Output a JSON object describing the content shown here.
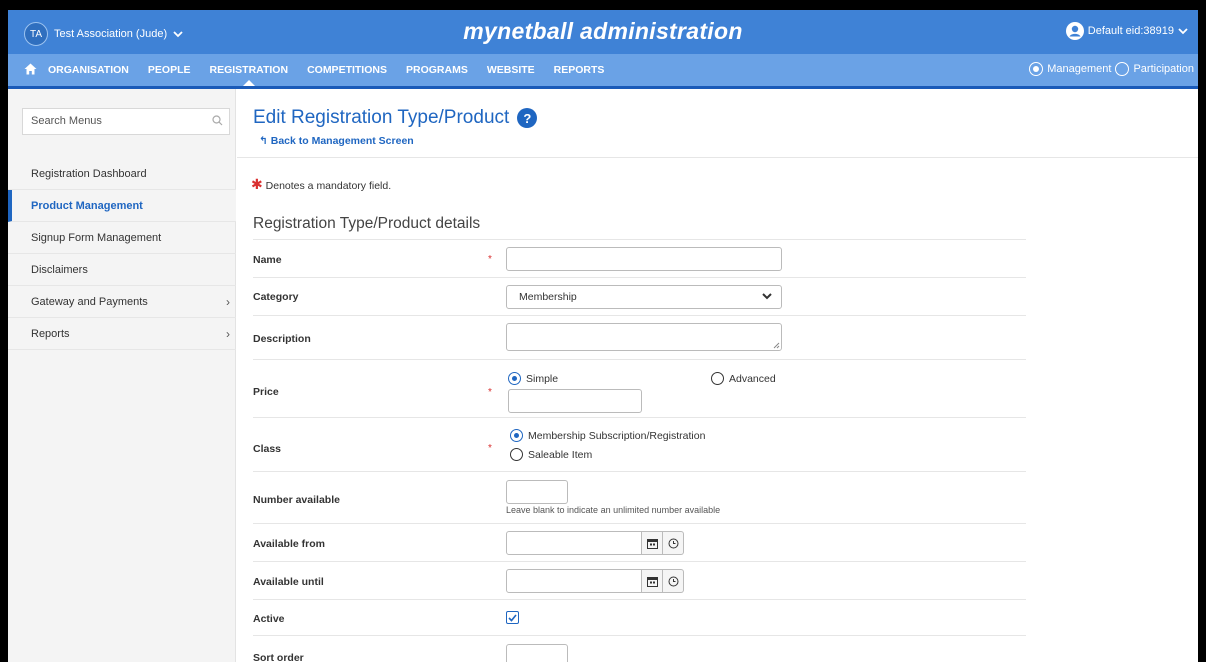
{
  "header": {
    "org_initials": "TA",
    "org_name": "Test Association (Jude)",
    "brand": "mynetball administration",
    "user_label": "Default eid:38919"
  },
  "nav": {
    "items": [
      "ORGANISATION",
      "PEOPLE",
      "REGISTRATION",
      "COMPETITIONS",
      "PROGRAMS",
      "WEBSITE",
      "REPORTS"
    ],
    "active": "REGISTRATION",
    "modes": [
      "Management",
      "Participation"
    ],
    "selected_mode": "Management"
  },
  "sidebar": {
    "search_placeholder": "Search Menus",
    "items": [
      {
        "label": "Registration Dashboard",
        "active": false,
        "expandable": false
      },
      {
        "label": "Product Management",
        "active": true,
        "expandable": false
      },
      {
        "label": "Signup Form Management",
        "active": false,
        "expandable": false
      },
      {
        "label": "Disclaimers",
        "active": false,
        "expandable": false
      },
      {
        "label": "Gateway and Payments",
        "active": false,
        "expandable": true
      },
      {
        "label": "Reports",
        "active": false,
        "expandable": true
      }
    ]
  },
  "page": {
    "title": "Edit Registration Type/Product",
    "back_link": "Back to Management Screen",
    "mandatory_note": "Denotes a mandatory field.",
    "section_title": "Registration Type/Product details"
  },
  "form": {
    "name": {
      "label": "Name",
      "value": ""
    },
    "category": {
      "label": "Category",
      "value": "Membership"
    },
    "description": {
      "label": "Description",
      "value": ""
    },
    "price": {
      "label": "Price",
      "options": [
        "Simple",
        "Advanced"
      ],
      "selected": "Simple",
      "value": ""
    },
    "class": {
      "label": "Class",
      "options": [
        "Membership Subscription/Registration",
        "Saleable Item"
      ],
      "selected": "Membership Subscription/Registration"
    },
    "number_available": {
      "label": "Number available",
      "hint": "Leave blank to indicate an unlimited number available",
      "value": ""
    },
    "available_from": {
      "label": "Available from",
      "value": ""
    },
    "available_until": {
      "label": "Available until",
      "value": ""
    },
    "active": {
      "label": "Active",
      "checked": true
    },
    "sort_order": {
      "label": "Sort order",
      "value": ""
    }
  },
  "colors": {
    "topbar": "#3f82d6",
    "navbar": "#6aa2e6",
    "accent": "#1f66c1",
    "required": "#d93030"
  }
}
